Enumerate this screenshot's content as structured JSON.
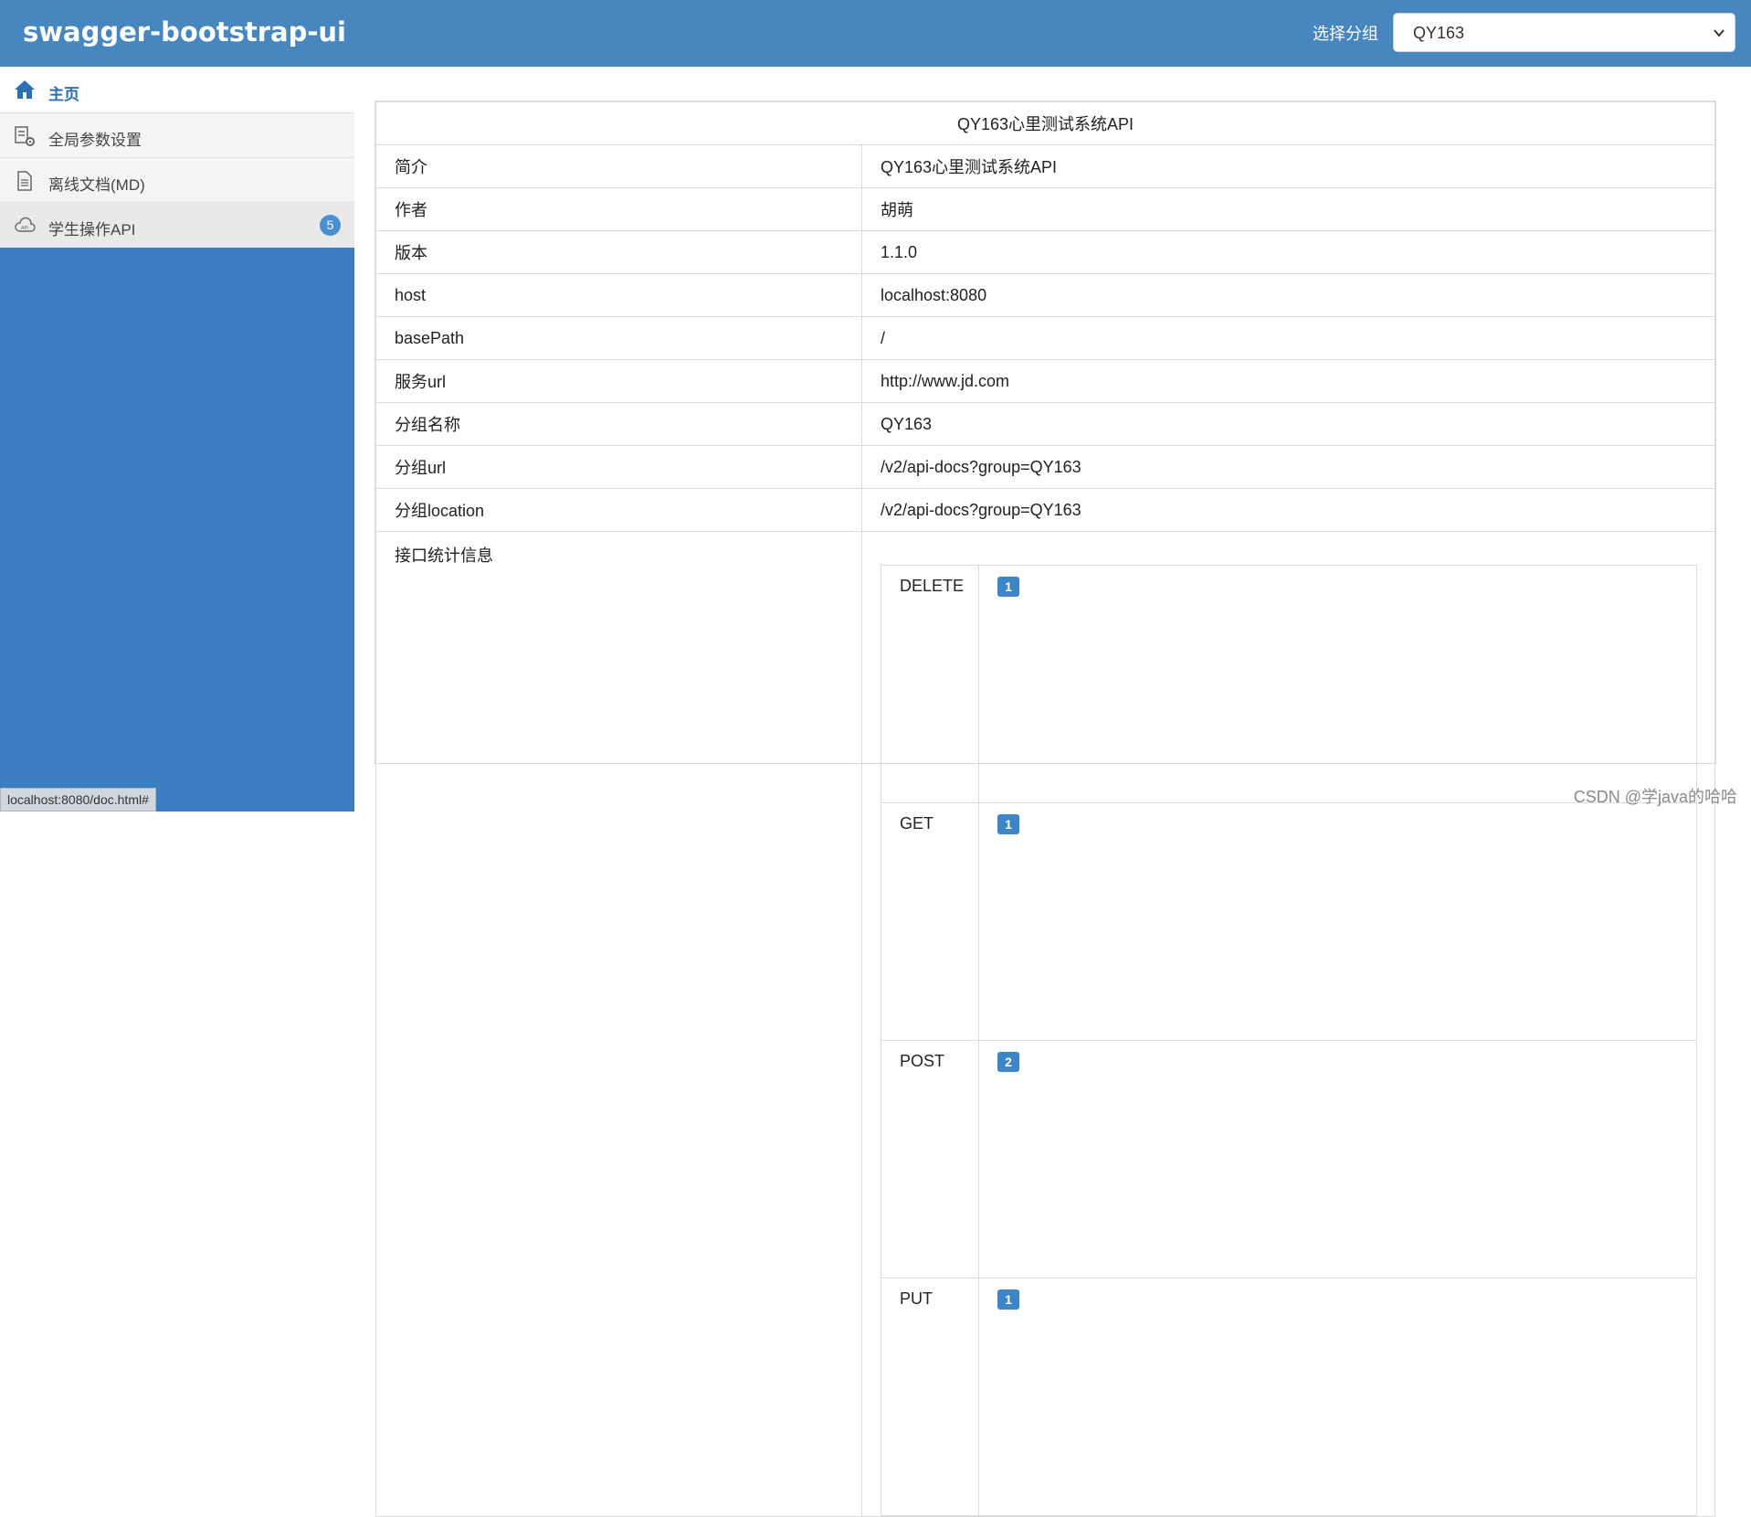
{
  "header": {
    "brand": "swagger-bootstrap-ui",
    "group_label": "选择分组",
    "group_selected": "QY163"
  },
  "sidebar": {
    "items": [
      {
        "label": "主页",
        "icon": "home-icon"
      },
      {
        "label": "全局参数设置",
        "icon": "settings-doc-icon"
      },
      {
        "label": "离线文档(MD)",
        "icon": "document-icon"
      },
      {
        "label": "学生操作API",
        "icon": "api-cloud-icon",
        "badge": "5"
      }
    ]
  },
  "main": {
    "title": "QY163心里测试系统API",
    "rows": [
      {
        "key": "简介",
        "value": "QY163心里测试系统API"
      },
      {
        "key": "作者",
        "value": "胡萌"
      },
      {
        "key": "版本",
        "value": "1.1.0"
      },
      {
        "key": "host",
        "value": "localhost:8080"
      },
      {
        "key": "basePath",
        "value": "/"
      },
      {
        "key": "服务url",
        "value": "http://www.jd.com"
      },
      {
        "key": "分组名称",
        "value": "QY163"
      },
      {
        "key": "分组url",
        "value": "/v2/api-docs?group=QY163"
      },
      {
        "key": "分组location",
        "value": "/v2/api-docs?group=QY163"
      }
    ],
    "stats_label": "接口统计信息",
    "stats": [
      {
        "method": "DELETE",
        "count": "1"
      },
      {
        "method": "GET",
        "count": "1"
      },
      {
        "method": "POST",
        "count": "2"
      },
      {
        "method": "PUT",
        "count": "1"
      }
    ]
  },
  "status_bar": "localhost:8080/doc.html#",
  "watermark": "CSDN @学java的哈哈",
  "colors": {
    "header_bg": "#4886bf",
    "sidebar_bg": "#3b7ec2",
    "badge": "#3d84c8",
    "active_link": "#2d6fae"
  }
}
